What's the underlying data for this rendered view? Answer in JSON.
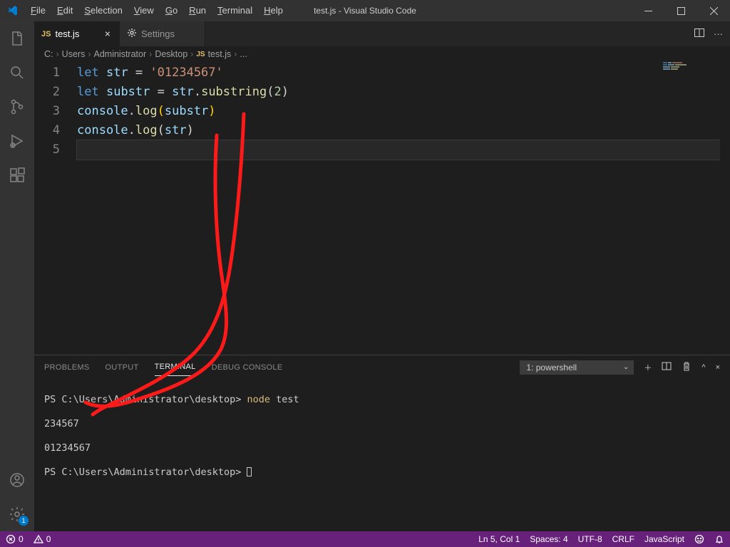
{
  "window": {
    "title": "test.js - Visual Studio Code"
  },
  "menu": {
    "file": "File",
    "edit": "Edit",
    "selection": "Selection",
    "view": "View",
    "go": "Go",
    "run": "Run",
    "terminal": "Terminal",
    "help": "Help"
  },
  "tabs": {
    "test": "test.js",
    "settings": "Settings"
  },
  "breadcrumbs": {
    "c": "C:",
    "users": "Users",
    "admin": "Administrator",
    "desktop": "Desktop",
    "file": "test.js",
    "more": "..."
  },
  "code": {
    "lines": [
      "1",
      "2",
      "3",
      "4",
      "5"
    ],
    "l1_kw": "let",
    "l1_var": "str",
    "l1_eq": " = ",
    "l1_str": "'01234567'",
    "l2_kw": "let",
    "l2_var": "substr",
    "l2_eq": " = ",
    "l2_obj": "str",
    "l2_dot": ".",
    "l2_fn": "substring",
    "l2_po": "(",
    "l2_num": "2",
    "l2_pc": ")",
    "l3_obj": "console",
    "l3_dot": ".",
    "l3_fn": "log",
    "l3_po": "(",
    "l3_arg": "substr",
    "l3_pc": ")",
    "l4_obj": "console",
    "l4_dot": ".",
    "l4_fn": "log",
    "l4_po": "(",
    "l4_arg": "str",
    "l4_pc": ")"
  },
  "panel": {
    "tabs": {
      "problems": "PROBLEMS",
      "output": "OUTPUT",
      "terminal": "TERMINAL",
      "debug": "DEBUG CONSOLE"
    },
    "select": "1: powershell"
  },
  "terminal": {
    "l1_prompt": "PS C:\\Users\\Administrator\\desktop> ",
    "l1_cmd": "node ",
    "l1_arg": "test",
    "l2": "234567",
    "l3": "01234567",
    "l4_prompt": "PS C:\\Users\\Administrator\\desktop> "
  },
  "statusbar": {
    "errors": "0",
    "warnings": "0",
    "pos": "Ln 5, Col 1",
    "spaces": "Spaces: 4",
    "enc": "UTF-8",
    "eol": "CRLF",
    "lang": "JavaScript"
  },
  "badges": {
    "settings": "1"
  }
}
